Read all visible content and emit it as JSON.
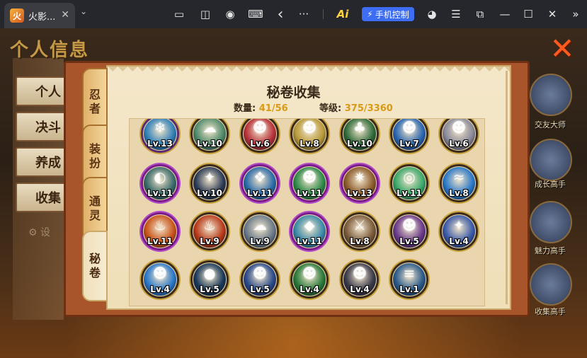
{
  "window": {
    "tab_title": "火影...",
    "close_glyph": "✕",
    "dropdown_glyph": "⌄",
    "phone_control_label": "手机控制",
    "ai_label": "Ai",
    "icons": {
      "cast": "▭",
      "screenshot": "◫",
      "record": "◉",
      "keyboard": "⌨",
      "back": "‹",
      "more": "···",
      "account": "◕",
      "menu": "☰",
      "popout": "⧉",
      "minimize": "—",
      "maximize": "☐",
      "close": "✕",
      "collapse": "»"
    }
  },
  "background": {
    "banner_title": "个人信息",
    "menu": [
      {
        "label": "个人"
      },
      {
        "label": "决斗"
      },
      {
        "label": "养成"
      },
      {
        "label": "收集"
      }
    ],
    "settings_label": "⚙ 设",
    "close_glyph": "✕",
    "right_list": [
      {
        "label": "交友大师"
      },
      {
        "label": "成长高手"
      },
      {
        "label": "魅力高手"
      },
      {
        "label": "收集高手"
      }
    ]
  },
  "panel": {
    "title": "秘卷收集",
    "count_label": "数量:",
    "count_value": "41/56",
    "level_label": "等级:",
    "level_value": "375/3360",
    "tabs": [
      {
        "label": "忍\n者"
      },
      {
        "label": "装\n扮"
      },
      {
        "label": "通\n灵"
      },
      {
        "label": "秘\n卷"
      }
    ],
    "colors": {
      "accent": "#d89a16",
      "frame": "#a8552c",
      "parchment": "#f4e7c9"
    },
    "scrolls": [
      {
        "level": "Lv.13",
        "icon": "❄",
        "ring": "#5a2a6e",
        "core": "#2f7fb8"
      },
      {
        "level": "Lv.10",
        "icon": "☁",
        "ring": "#3a2a1a",
        "core": "#4e8a6a"
      },
      {
        "level": "Lv.6",
        "icon": "☻",
        "ring": "#3a2a1a",
        "core": "#b8323a"
      },
      {
        "level": "Lv.8",
        "icon": "☻",
        "ring": "#3a2a1a",
        "core": "#b89a3a"
      },
      {
        "level": "Lv.10",
        "icon": "♣",
        "ring": "#3a2a1a",
        "core": "#2e6a3a"
      },
      {
        "level": "Lv.7",
        "icon": "☻",
        "ring": "#3a2a1a",
        "core": "#2a66b0"
      },
      {
        "level": "Lv.6",
        "icon": "☻",
        "ring": "#3a2a1a",
        "core": "#8a8a9a"
      },
      {
        "level": "Lv.11",
        "icon": "◐",
        "ring": "#7a1a8a",
        "core": "#3a6a6a"
      },
      {
        "level": "Lv.10",
        "icon": "✦",
        "ring": "#3a2a1a",
        "core": "#2a3a55"
      },
      {
        "level": "Lv.11",
        "icon": "❖",
        "ring": "#7a1a8a",
        "core": "#2a6aa8"
      },
      {
        "level": "Lv.11",
        "icon": "☻",
        "ring": "#7a1a8a",
        "core": "#2e8a4a"
      },
      {
        "level": "Lv.13",
        "icon": "✷",
        "ring": "#7a1a8a",
        "core": "#8a5a2a"
      },
      {
        "level": "Lv.11",
        "icon": "◎",
        "ring": "#3a2a1a",
        "core": "#3aa86a"
      },
      {
        "level": "Lv.8",
        "icon": "≈",
        "ring": "#3a2a1a",
        "core": "#2a78c8"
      },
      {
        "level": "Lv.11",
        "icon": "♨",
        "ring": "#7a1a8a",
        "core": "#c8541a"
      },
      {
        "level": "Lv.9",
        "icon": "♨",
        "ring": "#3a2a1a",
        "core": "#b83a1a"
      },
      {
        "level": "Lv.9",
        "icon": "☁",
        "ring": "#3a2a1a",
        "core": "#6a7a8a"
      },
      {
        "level": "Lv.11",
        "icon": "◆",
        "ring": "#7a1a8a",
        "core": "#3a8aa8"
      },
      {
        "level": "Lv.8",
        "icon": "⚔",
        "ring": "#3a2a1a",
        "core": "#7a5a3a"
      },
      {
        "level": "Lv.5",
        "icon": "☻",
        "ring": "#3a2a1a",
        "core": "#6a3a8a"
      },
      {
        "level": "Lv.4",
        "icon": "✦",
        "ring": "#3a2a1a",
        "core": "#3a5aa8"
      },
      {
        "level": "Lv.4",
        "icon": "☻",
        "ring": "#3a2a1a",
        "core": "#2a78c8"
      },
      {
        "level": "Lv.5",
        "icon": "●",
        "ring": "#3a2a1a",
        "core": "#1a3a5a"
      },
      {
        "level": "Lv.5",
        "icon": "☻",
        "ring": "#3a2a1a",
        "core": "#2a4a8a"
      },
      {
        "level": "Lv.4",
        "icon": "☻",
        "ring": "#3a2a1a",
        "core": "#2a7a3a"
      },
      {
        "level": "Lv.4",
        "icon": "☻",
        "ring": "#3a2a1a",
        "core": "#3a3a4a"
      },
      {
        "level": "Lv.1",
        "icon": "≡",
        "ring": "#3a2a1a",
        "core": "#2a5a8a"
      }
    ]
  }
}
